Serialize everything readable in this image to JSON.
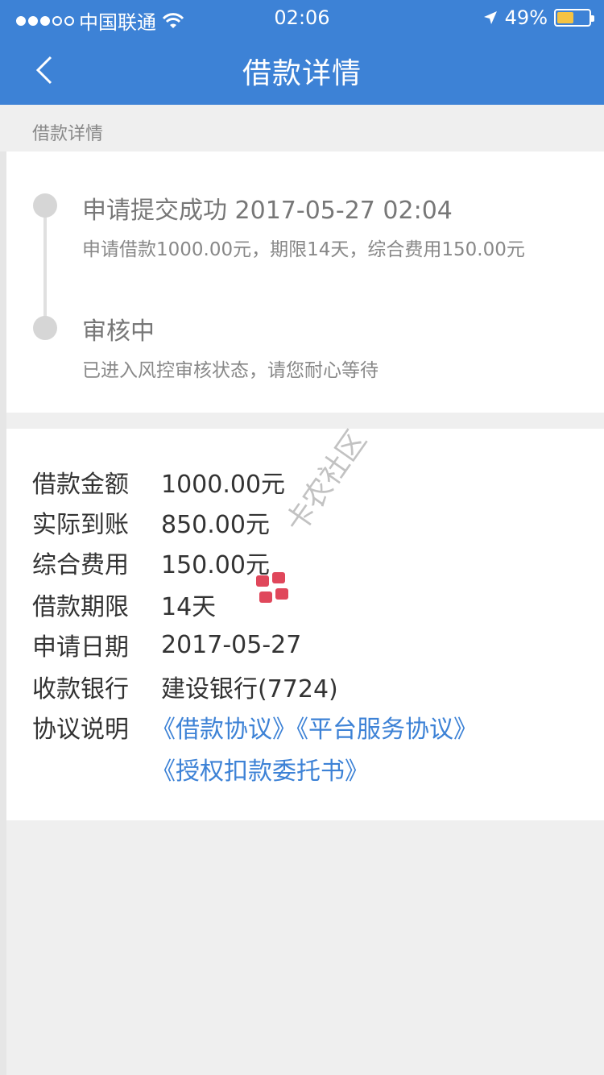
{
  "status_bar": {
    "carrier": "中国联通",
    "time": "02:06",
    "battery_percent": "49%",
    "battery_level": 0.49,
    "icons": [
      "signal-dots-icon",
      "wifi-icon",
      "location-arrow-icon",
      "battery-icon"
    ]
  },
  "nav": {
    "title": "借款详情",
    "back_icon": "chevron-left-icon"
  },
  "section": {
    "header": "借款详情"
  },
  "timeline": [
    {
      "title": "申请提交成功 2017-05-27 02:04",
      "desc": "申请借款1000.00元，期限14天，综合费用150.00元"
    },
    {
      "title": "审核中",
      "desc": "已进入风控审核状态，请您耐心等待"
    }
  ],
  "details": {
    "amount_label": "借款金额",
    "amount_value": "1000.00元",
    "received_label": "实际到账",
    "received_value": "850.00元",
    "fee_label": "综合费用",
    "fee_value": "150.00元",
    "term_label": "借款期限",
    "term_value": "14天",
    "date_label": "申请日期",
    "date_value": "2017-05-27",
    "bank_label": "收款银行",
    "bank_value": "建设银行(7724)",
    "agreement_label": "协议说明",
    "agreements": [
      "《借款协议》",
      "《平台服务协议》",
      "《授权扣款委托书》"
    ]
  },
  "watermark": {
    "text": "卡农社区"
  },
  "colors": {
    "primary": "#3d82d6",
    "link": "#3d82d6",
    "background": "#efefef"
  }
}
